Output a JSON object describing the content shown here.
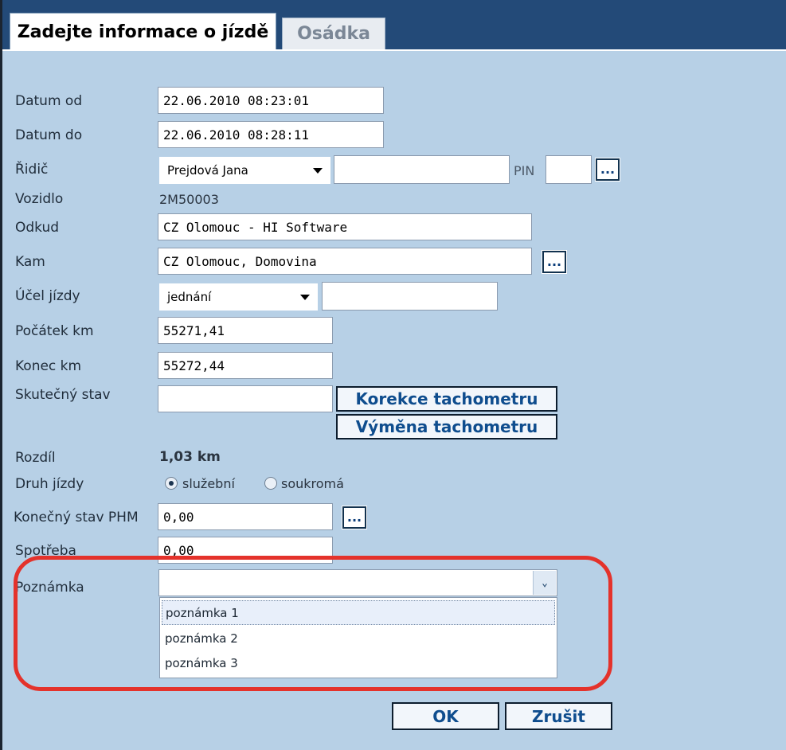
{
  "tabs": [
    {
      "label": "Zadejte informace o jízdě",
      "active": true
    },
    {
      "label": "Osádka",
      "active": false
    }
  ],
  "form": {
    "datum_od": {
      "label": "Datum od",
      "value": "22.06.2010 08:23:01"
    },
    "datum_do": {
      "label": "Datum do",
      "value": "22.06.2010 08:28:11"
    },
    "ridic": {
      "label": "Řidič",
      "selected": "Prejdová Jana",
      "extra": "",
      "pin_label": "PIN",
      "pin": ""
    },
    "vozidlo": {
      "label": "Vozidlo",
      "value": "2M50003"
    },
    "odkud": {
      "label": "Odkud",
      "value": "CZ Olomouc - HI Software"
    },
    "kam": {
      "label": "Kam",
      "value": "CZ Olomouc, Domovina"
    },
    "ucel": {
      "label": "Účel jízdy",
      "selected": "jednání",
      "extra": ""
    },
    "pocatek": {
      "label": "Počátek km",
      "value": "55271,41"
    },
    "konec": {
      "label": "Konec km",
      "value": "55272,44"
    },
    "skutecny": {
      "label": "Skutečný stav",
      "value": ""
    },
    "rozdil": {
      "label": "Rozdíl",
      "value": "1,03 km"
    },
    "druh": {
      "label": "Druh jízdy",
      "options": [
        "služební",
        "soukromá"
      ],
      "selected": "služební"
    },
    "phm": {
      "label": "Konečný stav PHM",
      "value": "0,00"
    },
    "spotreba": {
      "label": "Spotřeba",
      "value": "0,00"
    },
    "poznamka": {
      "label": "Poznámka",
      "value": "",
      "options": [
        "poznámka 1",
        "poznámka 2",
        "poznámka 3"
      ],
      "highlighted": "poznámka 1"
    }
  },
  "buttons": {
    "ellipsis": "...",
    "korekce": "Korekce tachometru",
    "vymena": "Výměna tachometru",
    "ok": "OK",
    "zrusit": "Zrušit"
  },
  "colors": {
    "panel_bg": "#b7d0e6",
    "header_bg": "#234a78",
    "highlight_ring": "#e4322b"
  }
}
